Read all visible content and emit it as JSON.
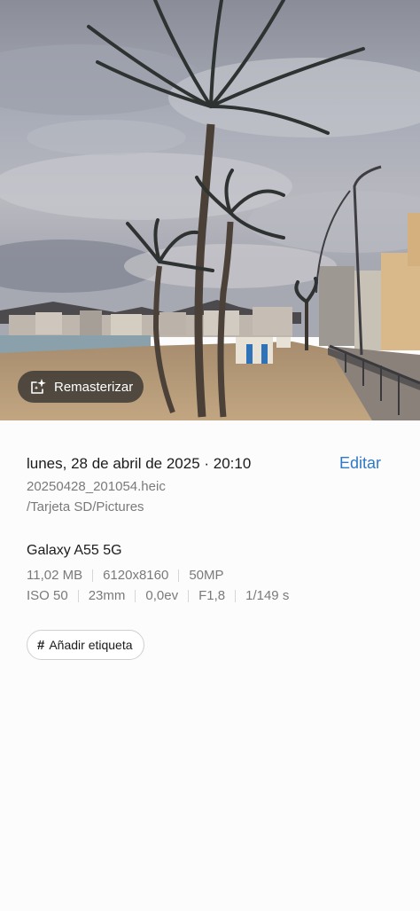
{
  "photo": {
    "remaster_label": "Remasterizar",
    "remaster_icon": "sparkle-frame-icon"
  },
  "details": {
    "date_time": "lunes, 28 de abril de 2025 · 20:10",
    "edit_label": "Editar",
    "filename": "20250428_201054.heic",
    "path": "/Tarjeta SD/Pictures",
    "device": "Galaxy A55 5G",
    "file_specs": [
      "11,02 MB",
      "6120x8160",
      "50MP"
    ],
    "camera_specs": [
      "ISO 50",
      "23mm",
      "0,0ev",
      "F1,8",
      "1/149 s"
    ],
    "tag_icon": "hash-icon",
    "tag_label": "Añadir etiqueta"
  },
  "colors": {
    "accent": "#2f79c6",
    "secondary_text": "#7a7a7a",
    "primary_text": "#1c1c1c"
  }
}
